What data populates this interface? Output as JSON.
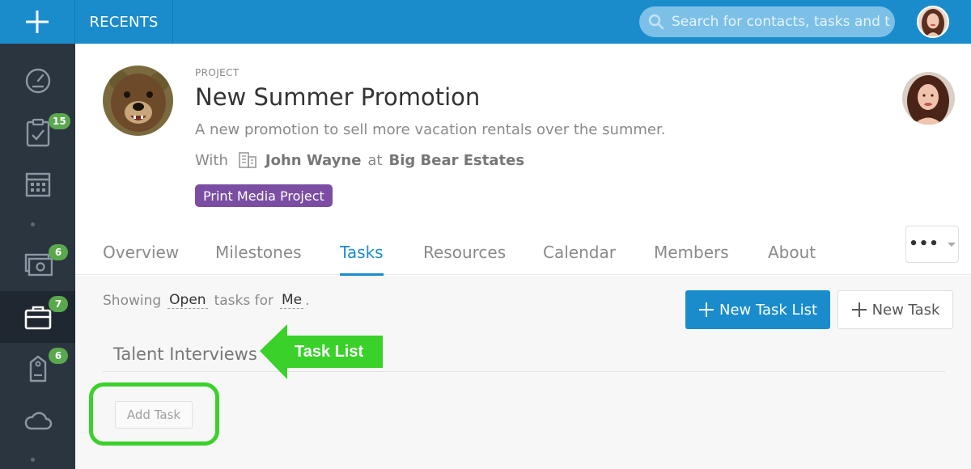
{
  "topbar": {
    "recents_label": "RECENTS",
    "search_placeholder": "Search for contacts, tasks and t",
    "accent_color": "#1a8ccc"
  },
  "sidebar": {
    "items": [
      {
        "icon": "dashboard-icon",
        "badge": null
      },
      {
        "icon": "tasks-clipboard-icon",
        "badge": "15"
      },
      {
        "icon": "calendar-icon",
        "badge": null
      },
      {
        "icon": "money-icon",
        "badge": "6"
      },
      {
        "icon": "briefcase-icon",
        "badge": "7",
        "active": true
      },
      {
        "icon": "tag-icon",
        "badge": "6"
      },
      {
        "icon": "cloud-icon",
        "badge": null
      }
    ]
  },
  "project": {
    "label": "PROJECT",
    "title": "New Summer Promotion",
    "description": "A new promotion to sell more vacation rentals over the summer.",
    "with_label": "With",
    "contact": "John Wayne",
    "at_label": "at",
    "organization": "Big Bear Estates",
    "tag": "Print Media Project",
    "tag_color": "#7b4da3"
  },
  "tabs": [
    "Overview",
    "Milestones",
    "Tasks",
    "Resources",
    "Calendar",
    "Members",
    "About"
  ],
  "active_tab": "Tasks",
  "more_button_label": "•••",
  "filter": {
    "prefix": "Showing",
    "status": "Open",
    "middle": "tasks for",
    "assignee": "Me",
    "suffix": "."
  },
  "buttons": {
    "new_task_list": "New Task List",
    "new_task": "New Task"
  },
  "task_list": {
    "title": "Talent Interviews",
    "add_task_label": "Add Task"
  },
  "annotation": {
    "label": "Task List",
    "color": "#3ad12a"
  }
}
